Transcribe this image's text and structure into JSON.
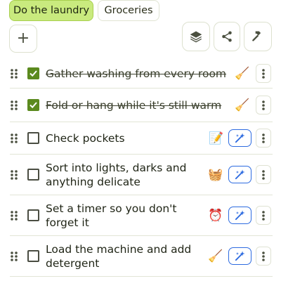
{
  "tabs": [
    {
      "label": "Do the laundry",
      "active": true
    },
    {
      "label": "Groceries",
      "active": false
    }
  ],
  "toolbar": {
    "add_label": "+",
    "layers_icon": "layers-icon",
    "share_icon": "share-icon",
    "hammer_icon": "hammer-icon"
  },
  "colors": {
    "active_tab_bg": "#c9ea7e",
    "checked_box": "#5b8a1e",
    "magic_button_border": "#2d6be0"
  },
  "tasks": [
    {
      "text": "Gather washing from every room",
      "done": true,
      "emoji": "🧹",
      "emoji_name": "broom-icon",
      "magic_button": false
    },
    {
      "text": "Fold or hang while it's still warm",
      "done": true,
      "emoji": "🧹",
      "emoji_name": "broom-icon",
      "magic_button": false
    },
    {
      "text": "Check pockets",
      "done": false,
      "emoji": "📝",
      "emoji_name": "memo-icon",
      "magic_button": true
    },
    {
      "text": "Sort into lights, darks and anything delicate",
      "done": false,
      "emoji": "🧺",
      "emoji_name": "basket-icon",
      "magic_button": true
    },
    {
      "text": "Set a timer so you don't forget it",
      "done": false,
      "emoji": "⏰",
      "emoji_name": "alarm-clock-icon",
      "magic_button": true
    },
    {
      "text": "Load the machine and add detergent",
      "done": false,
      "emoji": "🧹",
      "emoji_name": "broom-icon",
      "magic_button": true
    }
  ]
}
